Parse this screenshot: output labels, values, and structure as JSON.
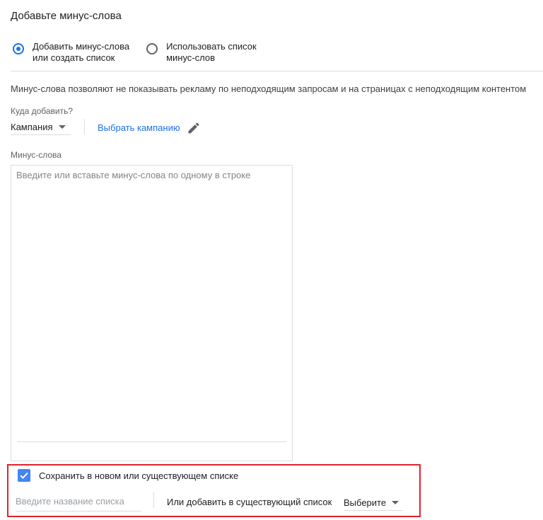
{
  "title": "Добавьте минус-слова",
  "mode": {
    "options": [
      {
        "line1": "Добавить минус-слова",
        "line2": "или создать список",
        "checked": true
      },
      {
        "line1": "Использовать список",
        "line2": "минус-слов",
        "checked": false
      }
    ]
  },
  "description": "Минус-слова позволяют не показывать рекламу по неподходящим запросам и на страницах с неподходящим контентом",
  "target": {
    "label": "Куда добавить?",
    "selected": "Кампания",
    "choose_link": "Выбрать кампанию",
    "edit_icon": "pencil-icon"
  },
  "keywords": {
    "label": "Минус-слова",
    "placeholder": "Введите или вставьте минус-слова по одному в строке",
    "value": ""
  },
  "save_list": {
    "checked": true,
    "label": "Сохранить в новом или существующем списке",
    "name_placeholder": "Введите название списка",
    "or_label": "Или добавить в существующий список",
    "select_value": "Выберите"
  },
  "colors": {
    "accent": "#1a73e8",
    "checkbox": "#4285f4",
    "highlight": "#e0232c"
  }
}
